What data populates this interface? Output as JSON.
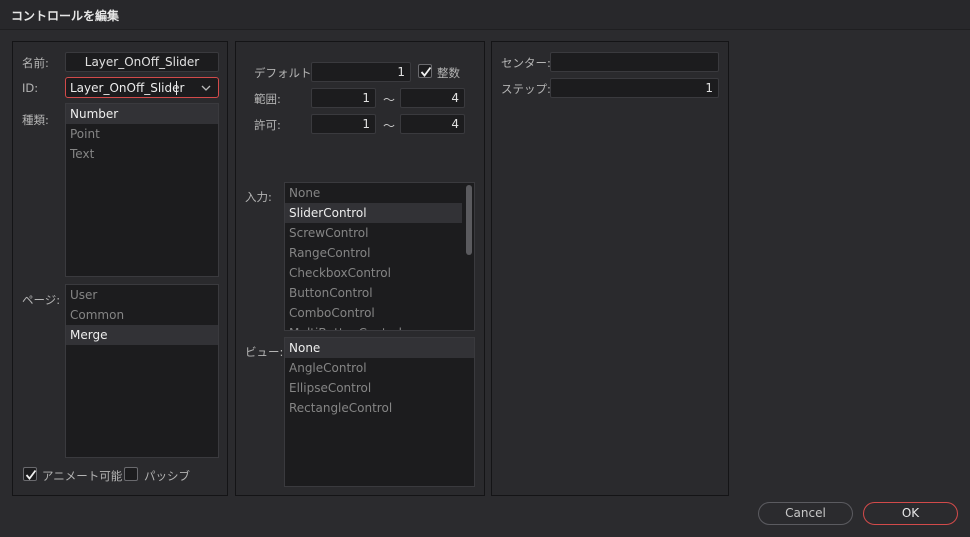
{
  "window": {
    "title": "コントロールを編集"
  },
  "left": {
    "name_label": "名前:",
    "name_value": "Layer_OnOff_Slider",
    "id_label": "ID:",
    "id_value": "Layer_OnOff_Slider",
    "type_label": "種類:",
    "type_items": [
      {
        "label": "Number",
        "selected": true
      },
      {
        "label": "Point",
        "selected": false
      },
      {
        "label": "Text",
        "selected": false
      }
    ],
    "page_label": "ページ:",
    "page_items": [
      {
        "label": "User",
        "selected": false
      },
      {
        "label": "Common",
        "selected": false
      },
      {
        "label": "Merge",
        "selected": true
      }
    ],
    "animate_label": "アニメート可能",
    "animate_checked": true,
    "passive_label": "パッシブ",
    "passive_checked": false
  },
  "middle": {
    "default_label": "デフォルト:",
    "default_value": "1",
    "integer_label": "整数",
    "integer_checked": true,
    "range_label": "範囲:",
    "range_min": "1",
    "range_max": "4",
    "allow_label": "許可:",
    "allow_min": "1",
    "allow_max": "4",
    "tilde": "〜",
    "input_label": "入力:",
    "input_items": [
      {
        "label": "None",
        "selected": false
      },
      {
        "label": "SliderControl",
        "selected": true
      },
      {
        "label": "ScrewControl",
        "selected": false
      },
      {
        "label": "RangeControl",
        "selected": false
      },
      {
        "label": "CheckboxControl",
        "selected": false
      },
      {
        "label": "ButtonControl",
        "selected": false
      },
      {
        "label": "ComboControl",
        "selected": false
      },
      {
        "label": "MultiButtonControl",
        "selected": false
      }
    ],
    "view_label": "ビュー:",
    "view_items": [
      {
        "label": "None",
        "selected": true
      },
      {
        "label": "AngleControl",
        "selected": false
      },
      {
        "label": "EllipseControl",
        "selected": false
      },
      {
        "label": "RectangleControl",
        "selected": false
      }
    ]
  },
  "right": {
    "center_label": "センター:",
    "center_value": "",
    "step_label": "ステップ:",
    "step_value": "1"
  },
  "footer": {
    "cancel_label": "Cancel",
    "ok_label": "OK"
  },
  "colors": {
    "accent": "#d24a4a",
    "background": "#2b2b2e",
    "field": "#1c1c1e",
    "selected_row": "#323236"
  },
  "icons": {
    "combo": "chevron-down-icon",
    "check": "checkmark-icon"
  }
}
